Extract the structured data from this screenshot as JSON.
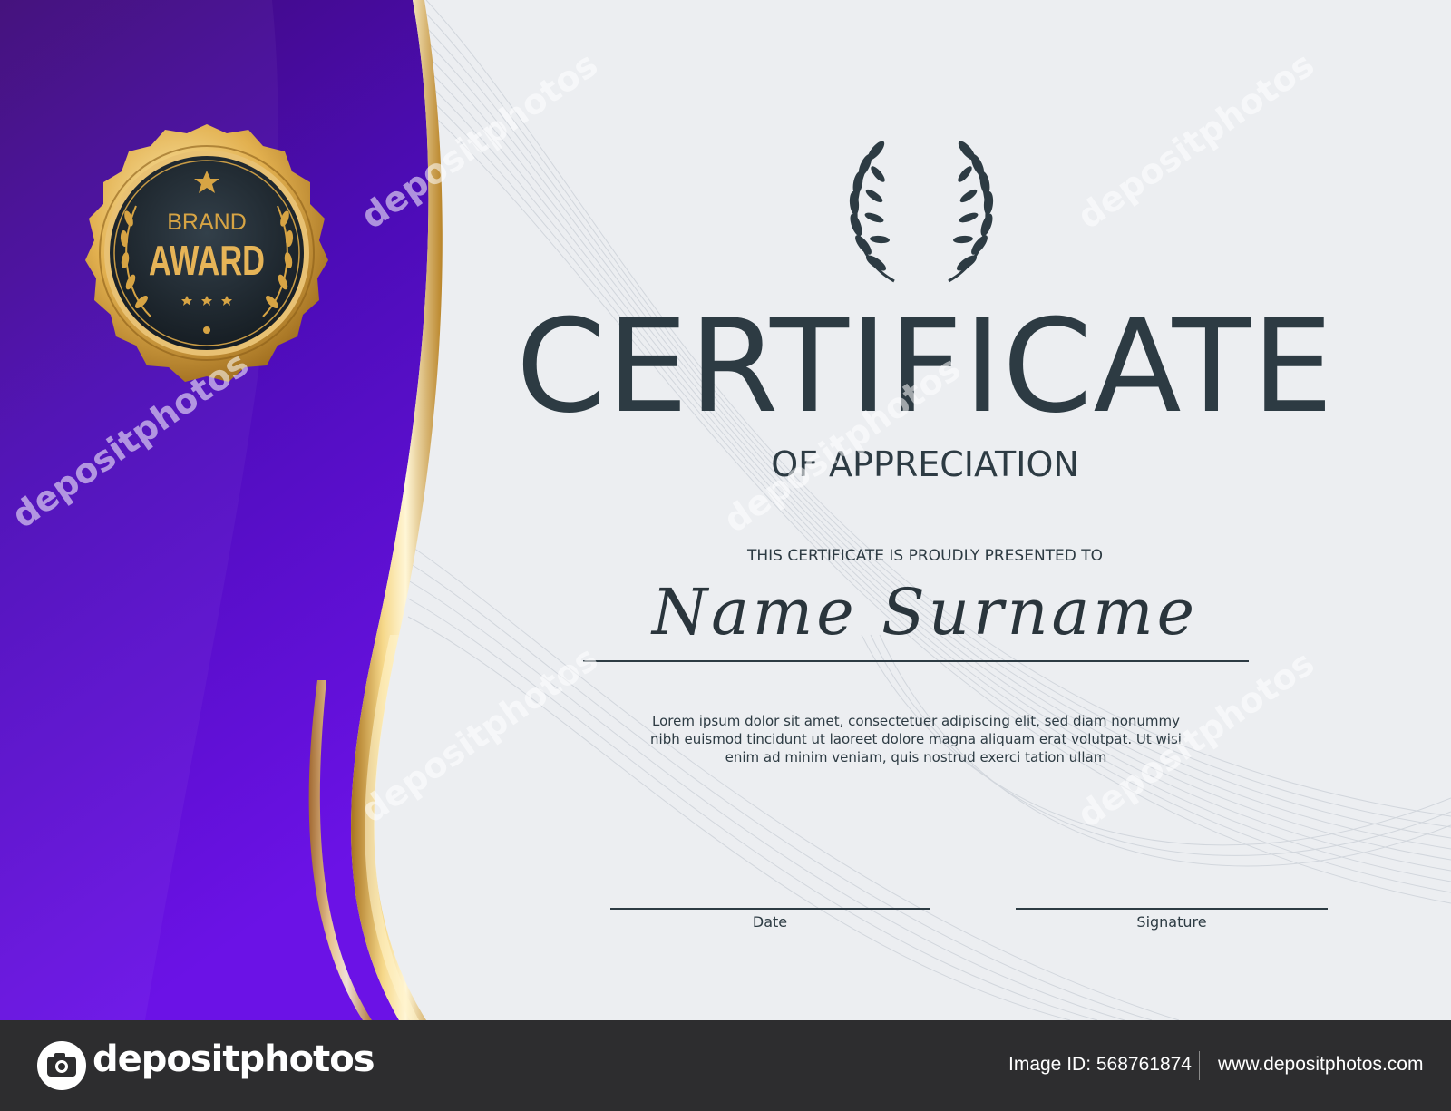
{
  "certificate": {
    "title": "CERTIFICATE",
    "subtitle": "OF APPRECIATION",
    "presented_text": "THIS CERTIFICATE IS PROUDLY PRESENTED TO",
    "recipient": "Name Surname",
    "body": "Lorem ipsum dolor sit amet, consectetuer adipiscing elit, sed diam nonummy nibh euismod tincidunt ut laoreet dolore magna aliquam erat volutpat. Ut wisi enim ad minim veniam, quis nostrud exerci tation ullam",
    "date_label": "Date",
    "signature_label": "Signature"
  },
  "badge": {
    "line1": "BRAND",
    "line2": "AWARD",
    "icons": [
      "star-icon",
      "laurel-wreath-icon"
    ]
  },
  "watermark": {
    "text": "depositphotos"
  },
  "footer": {
    "logo_text": "depositphotos",
    "image_id": "Image ID: 568761874",
    "site_url": "www.depositphotos.com"
  },
  "colors": {
    "purple_dark": "#3e0a78",
    "purple_bright": "#6b12e6",
    "gold": "#d7a444",
    "text_dark": "#2d3b43",
    "background": "#eceef1",
    "footer": "#2d2d2f"
  }
}
